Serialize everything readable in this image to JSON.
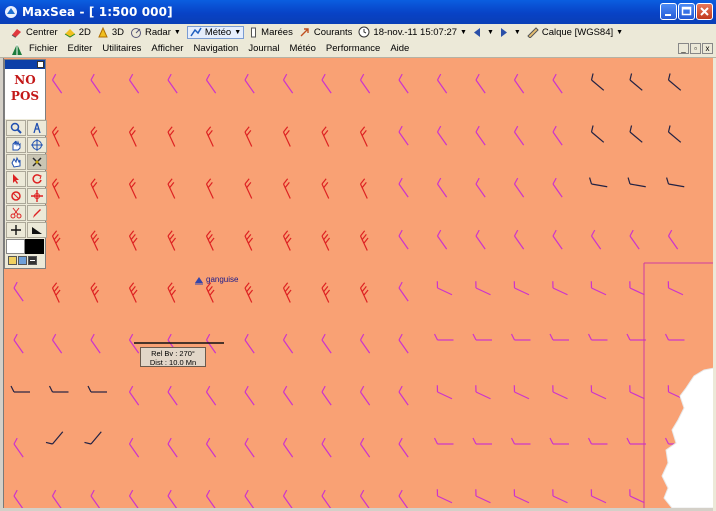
{
  "window": {
    "title": "MaxSea - [ 1:500 000]"
  },
  "toolbar": {
    "center": "Centrer",
    "view2d": "2D",
    "view3d": "3D",
    "radar": "Radar",
    "meteo": "Météo",
    "tides": "Marées",
    "currents": "Courants",
    "datetime": "18-nov.-11 15:07:27",
    "layer": "Calque [WGS84]"
  },
  "menu": [
    "Fichier",
    "Editer",
    "Utilitaires",
    "Afficher",
    "Navigation",
    "Journal",
    "Météo",
    "Performance",
    "Aide"
  ],
  "palette": {
    "line1": "NO",
    "line2": "POS"
  },
  "map": {
    "boat_label": "ganguise",
    "bearing_line1": "Rel Bv : 270°",
    "bearing_line2": "Dist : 10.0 Mn"
  },
  "colors": {
    "sea": "#f9a174",
    "titlebar": "#0a4ed0",
    "wind_calm": "#cc33cc",
    "wind_strong": "#dd2222",
    "wind_dark": "#222244"
  }
}
